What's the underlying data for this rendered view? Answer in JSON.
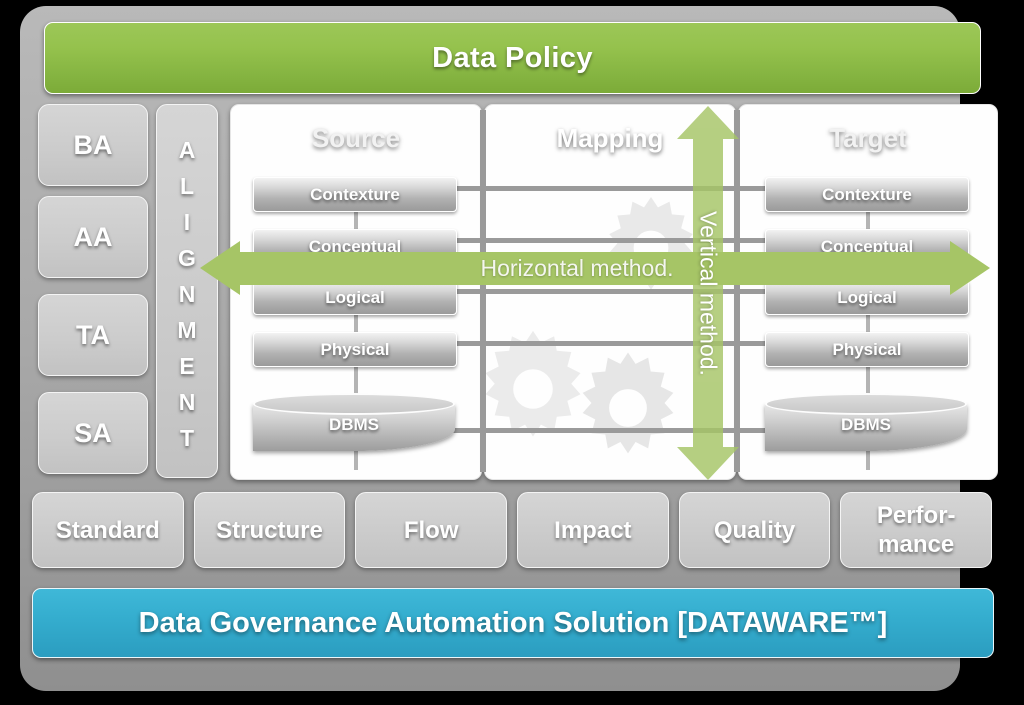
{
  "header": {
    "title": "Data Policy",
    "color": "#8fbe46"
  },
  "architecture_column": {
    "items": [
      {
        "label": "BA"
      },
      {
        "label": "AA"
      },
      {
        "label": "TA"
      },
      {
        "label": "SA"
      }
    ]
  },
  "alignment_column": {
    "letters": [
      "A",
      "L",
      "I",
      "G",
      "N",
      "M",
      "E",
      "N",
      "T"
    ]
  },
  "panels": [
    {
      "id": "source",
      "title": "Source",
      "layers": [
        "Contexture",
        "Conceptual",
        "Logical",
        "Physical"
      ],
      "store": "DBMS"
    },
    {
      "id": "mapping",
      "title": "Mapping"
    },
    {
      "id": "target",
      "title": "Target",
      "layers": [
        "Contexture",
        "Conceptual",
        "Logical",
        "Physical"
      ],
      "store": "DBMS"
    }
  ],
  "methods": {
    "horizontal": "Horizontal method.",
    "vertical": "Vertical method.",
    "arrow_color": "#a6c566"
  },
  "capabilities": [
    {
      "label": "Standard"
    },
    {
      "label": "Structure"
    },
    {
      "label": "Flow"
    },
    {
      "label": "Impact"
    },
    {
      "label": "Quality"
    },
    {
      "label": "Perfor-\nmance"
    }
  ],
  "footer": {
    "title": "Data Governance Automation Solution [DATAWARE™]",
    "color": "#34acce"
  }
}
